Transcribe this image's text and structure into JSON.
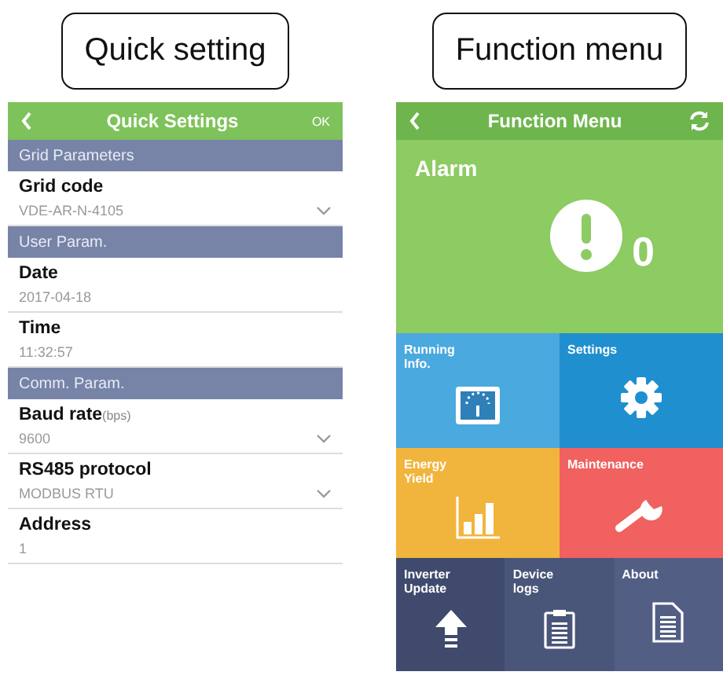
{
  "quick_setting": {
    "caption": "Quick setting",
    "title": "Quick Settings",
    "action": "OK",
    "sections": [
      {
        "title": "Grid Parameters",
        "fields": [
          {
            "label": "Grid code",
            "value": "VDE-AR-N-4105",
            "kind": "dropdown"
          }
        ]
      },
      {
        "title": "User Param.",
        "fields": [
          {
            "label": "Date",
            "value": "2017-04-18",
            "kind": "text"
          },
          {
            "label": "Time",
            "value": "11:32:57",
            "kind": "text"
          }
        ]
      },
      {
        "title": "Comm. Param.",
        "fields": [
          {
            "label": "Baud rate",
            "unit": "(bps)",
            "value": "9600",
            "kind": "dropdown"
          },
          {
            "label": "RS485 protocol",
            "value": "MODBUS RTU",
            "kind": "dropdown"
          },
          {
            "label": "Address",
            "value": "1",
            "kind": "text"
          }
        ]
      }
    ]
  },
  "function_menu": {
    "caption": "Function menu",
    "title": "Function Menu",
    "alarm": {
      "label": "Alarm",
      "count": "0"
    },
    "rows": [
      {
        "tiles": [
          {
            "label": "Running Info.",
            "kind": "gauge",
            "color": "#4aa9df"
          },
          {
            "label": "Settings",
            "kind": "gear",
            "color": "#1f8fcf"
          }
        ]
      },
      {
        "tiles": [
          {
            "label": "Energy Yield",
            "kind": "chart",
            "color": "#f1b43c"
          },
          {
            "label": "Maintenance",
            "kind": "wrench",
            "color": "#f0615f"
          }
        ]
      },
      {
        "tiles": [
          {
            "label": "Inverter Update",
            "kind": "upload",
            "color": "#3f4a6d"
          },
          {
            "label": "Device logs",
            "kind": "clipboard",
            "color": "#4a5679"
          },
          {
            "label": "About",
            "kind": "document",
            "color": "#525e84"
          }
        ]
      }
    ]
  }
}
